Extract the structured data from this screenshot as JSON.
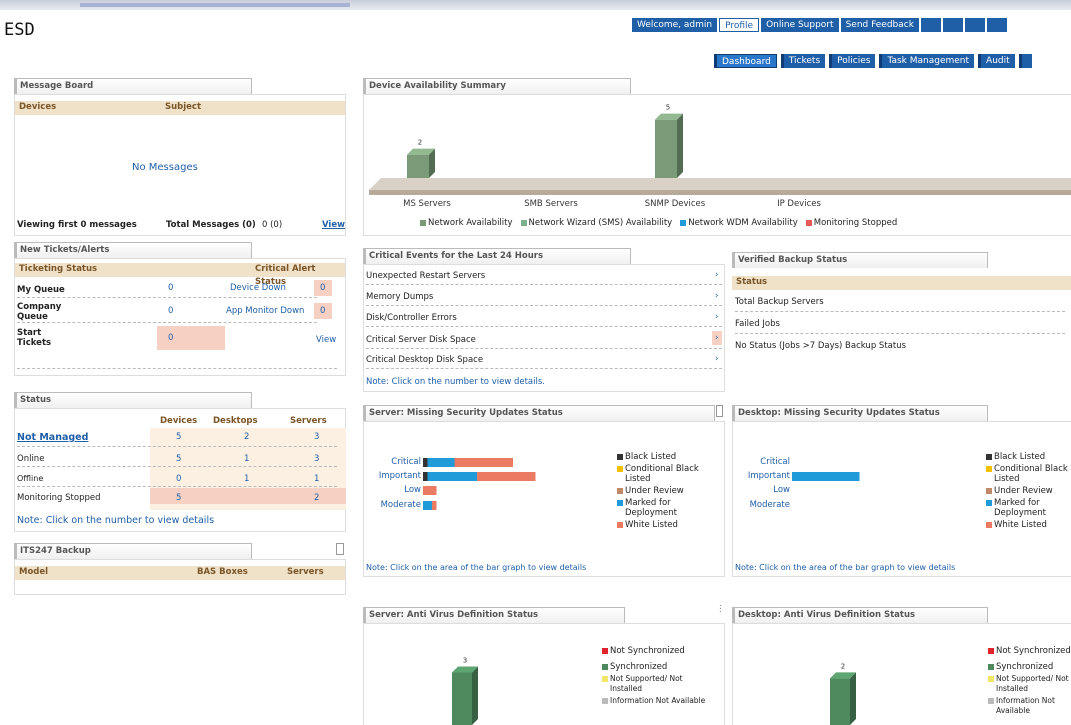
{
  "app": {
    "logo": "ESD"
  },
  "topnav": [
    "Welcome, admin",
    "Profile",
    "Online Support",
    "Send Feedback",
    "",
    "",
    "",
    ""
  ],
  "tabs": [
    "Dashboard",
    "Tickets",
    "Policies",
    "Task Management",
    "Audit",
    ""
  ],
  "message_board": {
    "title": "Message Board",
    "col_devices": "Devices",
    "col_subject": "Subject",
    "empty": "No Messages",
    "viewing": "Viewing first 0 messages",
    "total": "Total Messages (0)",
    "count": "0 (0)",
    "view_link": "View"
  },
  "new_tickets": {
    "title": "New Tickets/Alerts",
    "col_status": "Ticketing Status",
    "col_critical": "Critical Alert Status",
    "rows": [
      {
        "label": "My Queue",
        "value": "0",
        "alert": "Device Down",
        "alert_val": "0"
      },
      {
        "label": "Company Queue",
        "value": "0",
        "alert": "App Monitor Down",
        "alert_val": "0"
      },
      {
        "label": "Start Tickets",
        "value": "0",
        "alert": "",
        "alert_val": ""
      }
    ],
    "view_link": "View"
  },
  "status": {
    "title": "Status",
    "col_devices": "Devices",
    "col_desktops": "Desktops",
    "col_servers": "Servers",
    "rows": [
      {
        "label": "Not Managed",
        "d": "5",
        "k": "2",
        "s": "3"
      },
      {
        "label": "Online",
        "d": "5",
        "k": "1",
        "s": "3"
      },
      {
        "label": "Offline",
        "d": "0",
        "k": "1",
        "s": "1"
      },
      {
        "label": "Monitoring Stopped",
        "d": "5",
        "k": "",
        "s": "2"
      }
    ],
    "note": "Note: Click on the number to view details"
  },
  "backup": {
    "title": "ITS247 Backup",
    "col_model": "Model",
    "col_bds": "BAS Boxes",
    "col_servers": "Servers"
  },
  "availability": {
    "title": "Device Availability Summary",
    "legend": [
      "Network Availability",
      "Network Wizard (SMS) Availability",
      "Network WDM Availability",
      "Monitoring Stopped"
    ],
    "legend_colors": [
      "#7a9a78",
      "#7ab08c",
      "#1f9bd9",
      "#e85a5a"
    ]
  },
  "critical_events": {
    "title": "Critical Events for the Last 24 Hours",
    "rows": [
      "Unexpected Restart Servers",
      "Memory Dumps",
      "Disk/Controller Errors",
      "Critical Server Disk Space",
      "Critical Desktop Disk Space"
    ],
    "note": "Note: Click on the number to view details."
  },
  "verified_backup": {
    "title": "Verified Backup Status",
    "col_status": "Status",
    "rows": [
      "Total Backup Servers",
      "Failed Jobs",
      "No Status (Jobs >7 Days) Backup Status"
    ]
  },
  "server_security": {
    "title": "Server: Missing Security Updates Status",
    "note": "Note: Click on the area of the bar graph to view details"
  },
  "desktop_security": {
    "title": "Desktop: Missing Security Updates Status",
    "note": "Note: Click on the area of the bar graph to view details"
  },
  "security_legend": [
    "Black Listed",
    "Conditional Black Listed",
    "Under Review",
    "Marked for Deployment",
    "White Listed"
  ],
  "security_legend_colors": [
    "#333333",
    "#f2c100",
    "#c08a6a",
    "#1f9bd9",
    "#ea7a62"
  ],
  "server_av": {
    "title": "Server: Anti Virus Definition Status"
  },
  "desktop_av": {
    "title": "Desktop: Anti Virus Definition Status"
  },
  "av_legend": [
    "Not Synchronized",
    "Synchronized",
    "Not Supported/ Not Installed",
    "Information Not Available"
  ],
  "av_legend_colors": [
    "#e0242c",
    "#4e8a5e",
    "#f0e66a",
    "#bbbbbb"
  ],
  "charts": [
    {
      "type": "bar",
      "id": "availability",
      "categories": [
        "MS Servers",
        "SMB Servers",
        "SNMP Devices",
        "IP Devices"
      ],
      "values": [
        2,
        0,
        5,
        0
      ],
      "ylim": [
        0,
        6
      ]
    },
    {
      "type": "bar",
      "id": "server_security",
      "orientation": "horizontal",
      "stacked": true,
      "categories": [
        "Critical",
        "Important",
        "Low",
        "Moderate"
      ],
      "series": [
        {
          "name": "Black Listed",
          "values": [
            1,
            1,
            0,
            0
          ]
        },
        {
          "name": "Marked for Deployment",
          "values": [
            6,
            11,
            0,
            2
          ]
        },
        {
          "name": "White Listed",
          "values": [
            13,
            13,
            3,
            1
          ]
        }
      ]
    },
    {
      "type": "bar",
      "id": "desktop_security",
      "orientation": "horizontal",
      "stacked": true,
      "categories": [
        "Critical",
        "Important",
        "Low",
        "Moderate"
      ],
      "series": [
        {
          "name": "Marked for Deployment",
          "values": [
            0,
            15,
            0,
            0
          ]
        }
      ]
    },
    {
      "type": "bar",
      "id": "server_av",
      "categories": [
        "Synchronized"
      ],
      "values": [
        3
      ],
      "ylim": [
        0,
        4
      ]
    },
    {
      "type": "bar",
      "id": "desktop_av",
      "categories": [
        "Synchronized"
      ],
      "values": [
        2
      ],
      "ylim": [
        0,
        3
      ]
    }
  ]
}
